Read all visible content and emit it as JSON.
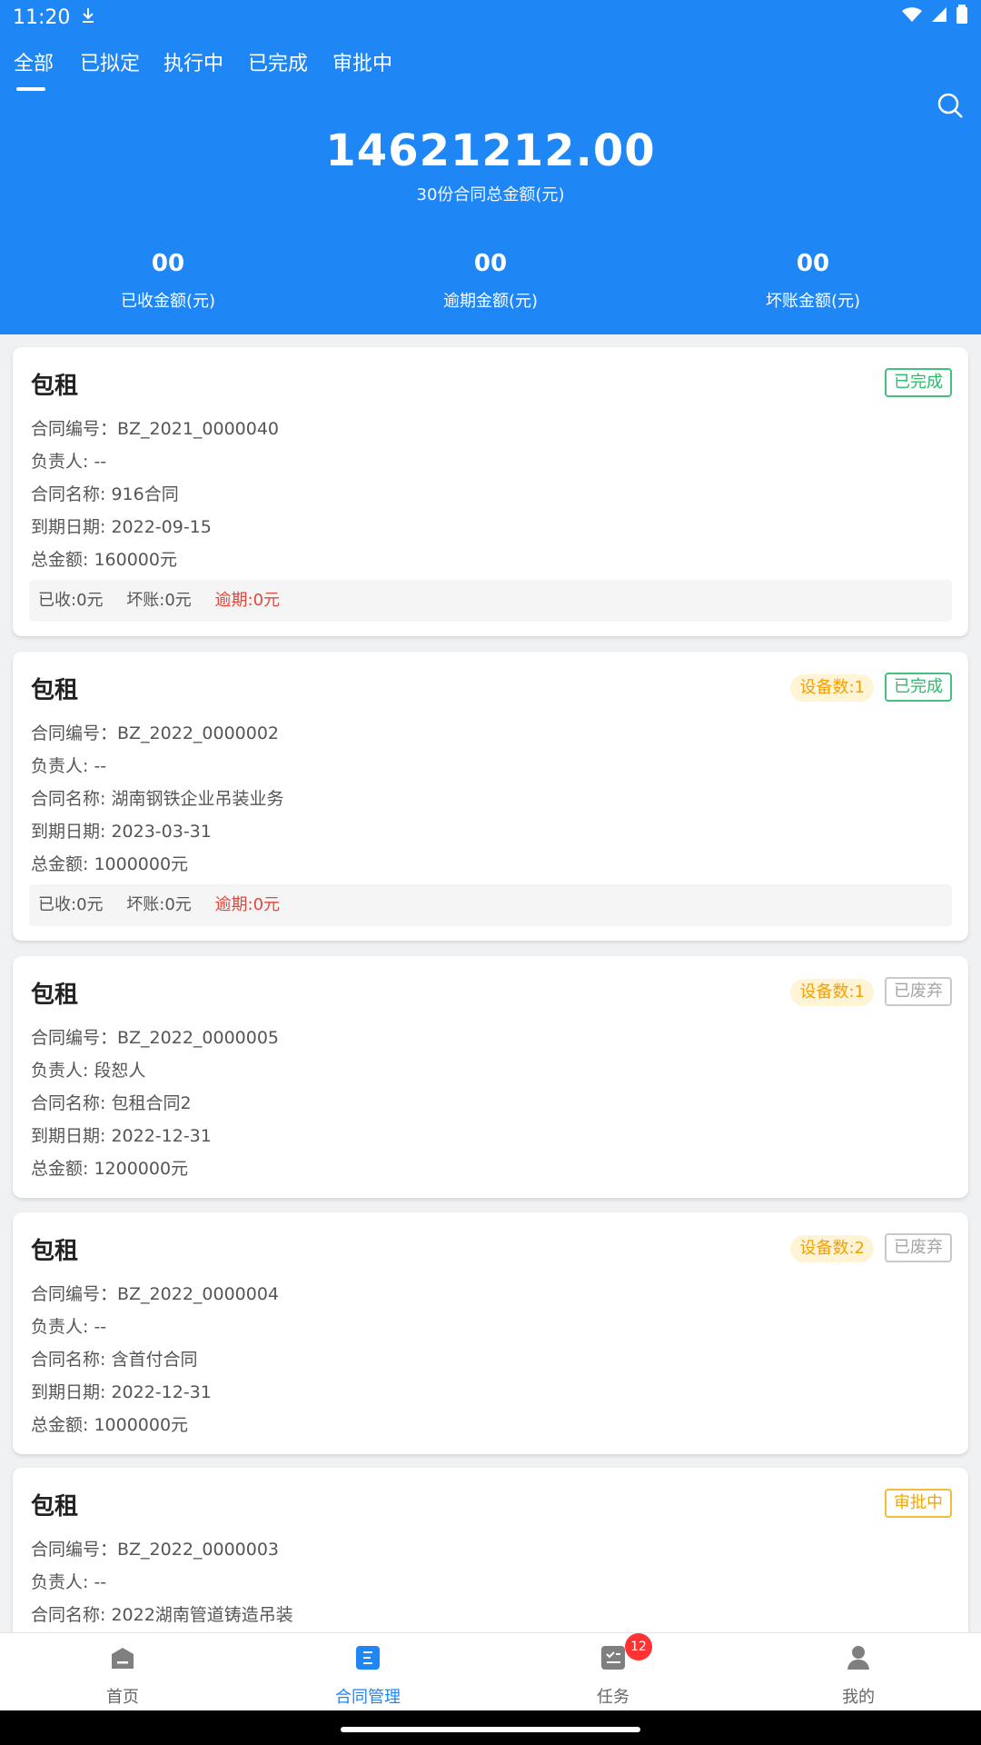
{
  "status_bar": {
    "time": "11:20",
    "icons": [
      "download-icon",
      "wifi-icon",
      "signal-icon",
      "battery-icon"
    ]
  },
  "tabs": [
    {
      "label": "全部",
      "active": true
    },
    {
      "label": "已拟定",
      "active": false
    },
    {
      "label": "执行中",
      "active": false
    },
    {
      "label": "已完成",
      "active": false
    },
    {
      "label": "审批中",
      "active": false
    }
  ],
  "summary": {
    "total_amount": "14621212.00",
    "total_caption": "30份合同总金额(元)",
    "metrics": [
      {
        "value": "00",
        "label": "已收金额(元)"
      },
      {
        "value": "00",
        "label": "逾期金额(元)"
      },
      {
        "value": "00",
        "label": "坏账金额(元)"
      }
    ]
  },
  "contracts": [
    {
      "title": "包租",
      "status": "已完成",
      "lines": [
        "合同编号：BZ_2021_0000040",
        "负责人: --",
        "合同名称: 916合同",
        "到期日期: 2022-09-15",
        "总金额: 160000元"
      ],
      "summary": {
        "received": "已收:0元",
        "bad_debt": "坏账:0元",
        "overdue": "逾期:0元"
      }
    },
    {
      "title": "包租",
      "device_count": "设备数:1",
      "status": "已完成",
      "lines": [
        "合同编号：BZ_2022_0000002",
        "负责人: --",
        "合同名称: 湖南钢铁企业吊装业务",
        "到期日期: 2023-03-31",
        "总金额: 1000000元"
      ],
      "summary": {
        "received": "已收:0元",
        "bad_debt": "坏账:0元",
        "overdue": "逾期:0元"
      }
    },
    {
      "title": "包租",
      "device_count": "设备数:1",
      "status": "已废弃",
      "lines": [
        "合同编号：BZ_2022_0000005",
        "负责人: 段恕人",
        "合同名称: 包租合同2",
        "到期日期: 2022-12-31",
        "总金额: 1200000元"
      ]
    },
    {
      "title": "包租",
      "device_count": "设备数:2",
      "status": "已废弃",
      "lines": [
        "合同编号：BZ_2022_0000004",
        "负责人: --",
        "合同名称: 含首付合同",
        "到期日期: 2022-12-31",
        "总金额: 1000000元"
      ]
    },
    {
      "title": "包租",
      "status": "审批中",
      "lines": [
        "合同编号：BZ_2022_0000003",
        "负责人: --",
        "合同名称: 2022湖南管道铸造吊装"
      ]
    }
  ],
  "bottom_nav": [
    {
      "label": "首页",
      "icon": "home-icon",
      "active": false
    },
    {
      "label": "合同管理",
      "icon": "contract-icon",
      "active": true
    },
    {
      "label": "任务",
      "icon": "task-icon",
      "active": false,
      "badge": "12"
    },
    {
      "label": "我的",
      "icon": "profile-icon",
      "active": false
    }
  ],
  "colors": {
    "primary": "#1f86f6",
    "done": "#2dbb6a",
    "abandoned": "#a6a6a6",
    "approving": "#f2a700",
    "overdue": "#e5463a"
  }
}
